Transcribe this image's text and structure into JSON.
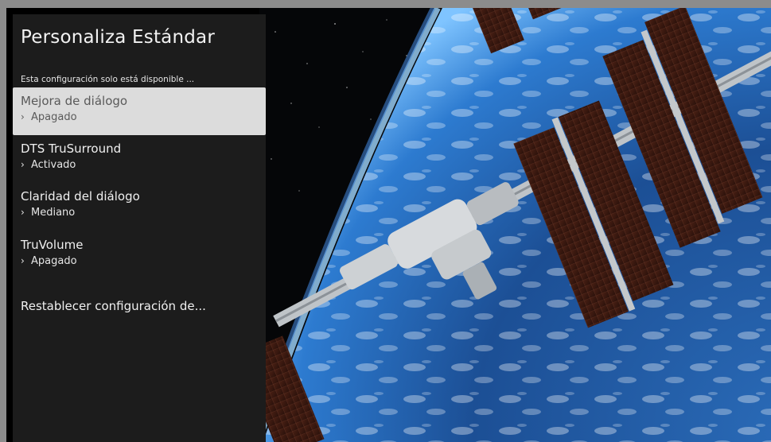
{
  "panel": {
    "title": "Personaliza Estándar",
    "note": "Esta configuración solo está disponible ..."
  },
  "menu": {
    "items": [
      {
        "label": "Mejora de diálogo",
        "value": "Apagado",
        "focused": true
      },
      {
        "label": "DTS TruSurround",
        "value": "Activado",
        "focused": false
      },
      {
        "label": "Claridad del diálogo",
        "value": "Mediano",
        "focused": false
      },
      {
        "label": "TruVolume",
        "value": "Apagado",
        "focused": false
      }
    ],
    "reset_label": "Restablecer configuración de...",
    "chevron": "›"
  },
  "background": {
    "image": "space-station-over-earth",
    "colors": {
      "space": "#050608",
      "ocean": "#1f4d8c",
      "atmosphere": "#6fb6ff",
      "solar_panel": "#3a1a12",
      "station": "#cfd3d6"
    }
  },
  "colors": {
    "panel_bg": "#1c1c1c",
    "focus_bg": "#dcdcdc",
    "text": "#f0f0f0",
    "focus_text": "#5a5a5a",
    "frame": "#8c8c8c"
  }
}
